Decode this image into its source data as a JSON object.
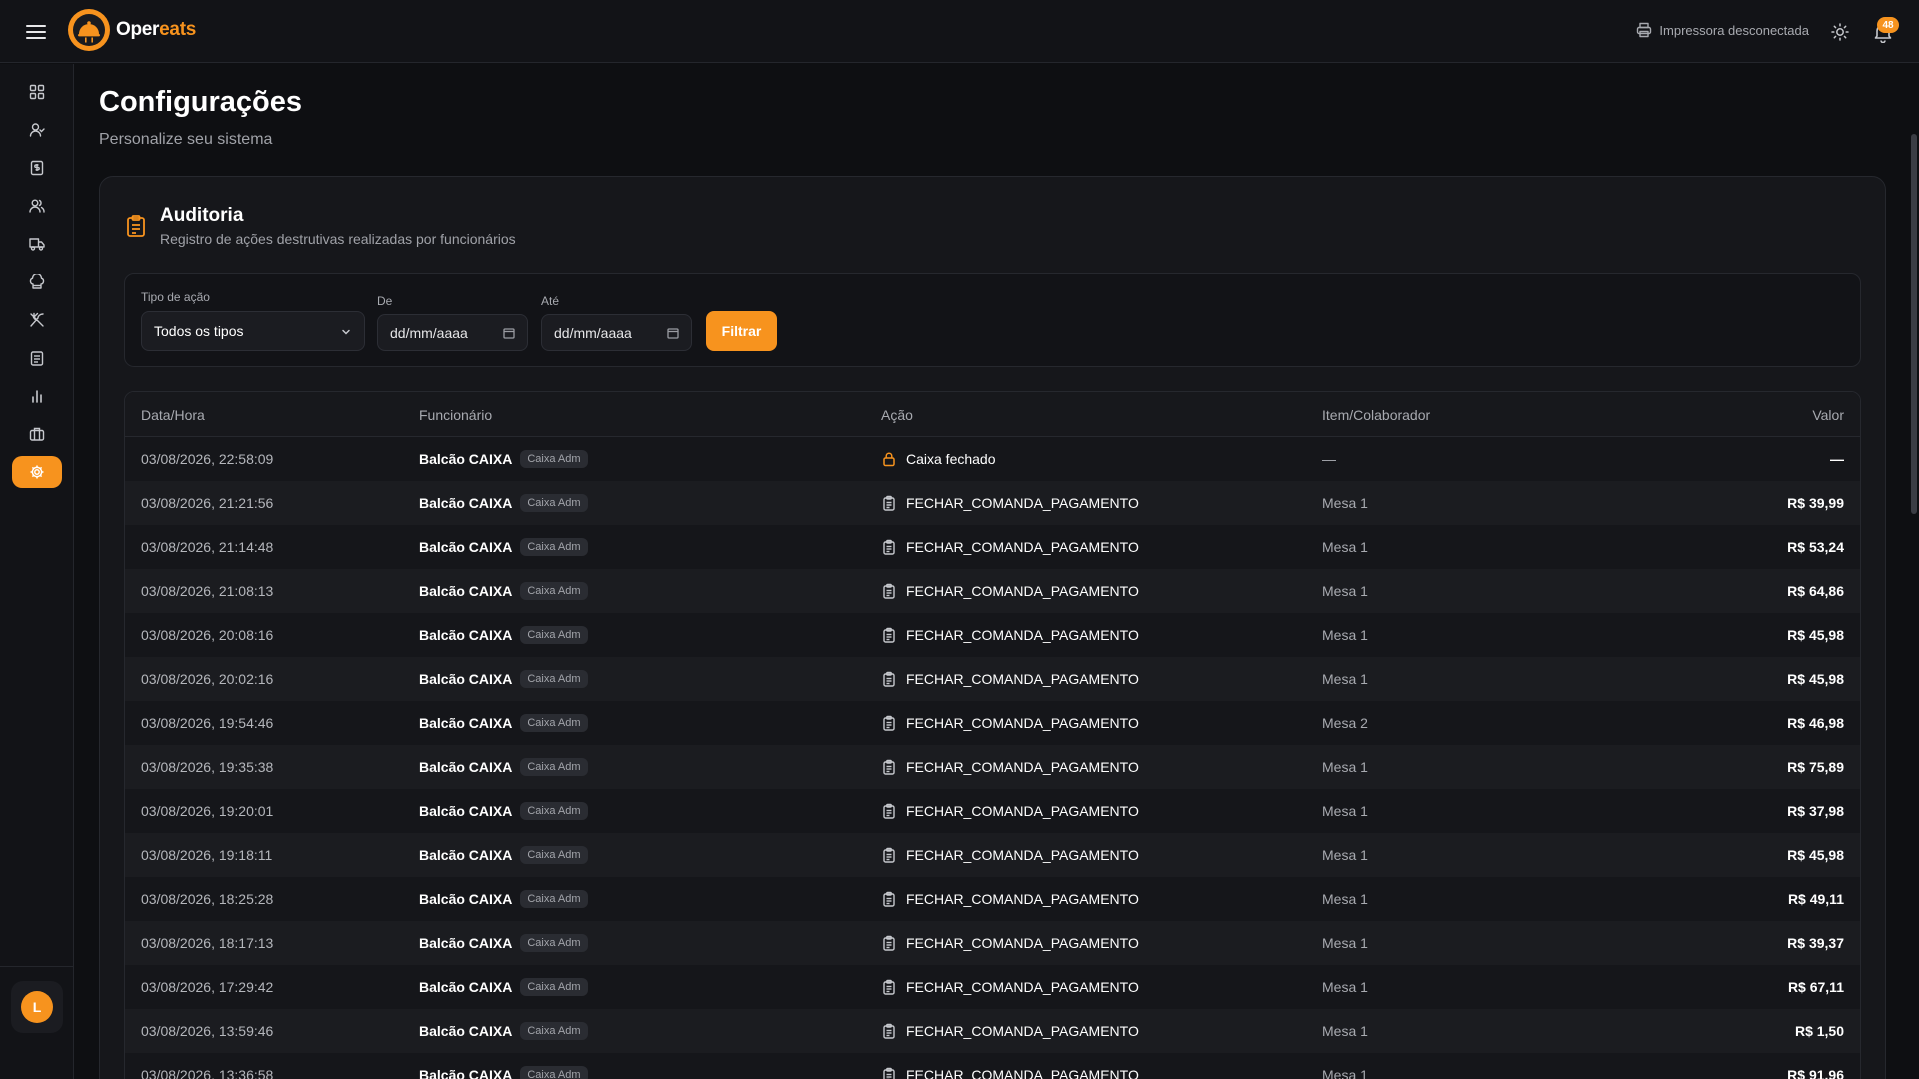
{
  "app": {
    "brand_a": "Oper",
    "brand_b": "eats",
    "printer_status": "Impressora desconectada",
    "notifications_count": "48"
  },
  "sidebar": {
    "icons": [
      "dashboard-icon",
      "user-check-icon",
      "receipt-icon",
      "users-icon",
      "truck-icon",
      "chef-hat-icon",
      "utensils-icon",
      "clipboard-icon",
      "bar-chart-icon",
      "briefcase-icon",
      "gear-icon"
    ],
    "active_index": 10,
    "user_initial": "L"
  },
  "page": {
    "title": "Configurações",
    "subtitle": "Personalize seu sistema"
  },
  "audit": {
    "title": "Auditoria",
    "subtitle": "Registro de ações destrutivas realizadas por funcionários",
    "filters": {
      "type_label": "Tipo de ação",
      "type_value": "Todos os tipos",
      "from_label": "De",
      "from_value": "dd/mm/aaaa",
      "to_label": "Até",
      "to_value": "dd/mm/aaaa",
      "button": "Filtrar"
    },
    "columns": [
      "Data/Hora",
      "Funcionário",
      "Ação",
      "Item/Colaborador",
      "Valor"
    ],
    "rows": [
      {
        "datetime": "03/08/2026, 22:58:09",
        "employee": "Balcão CAIXA",
        "role": "Caixa Adm",
        "action_icon": "lock-icon",
        "action": "Caixa fechado",
        "item": "—",
        "value": "—"
      },
      {
        "datetime": "03/08/2026, 21:21:56",
        "employee": "Balcão CAIXA",
        "role": "Caixa Adm",
        "action_icon": "clipboard-icon",
        "action": "FECHAR_COMANDA_PAGAMENTO",
        "item": "Mesa 1",
        "value": "R$ 39,99"
      },
      {
        "datetime": "03/08/2026, 21:14:48",
        "employee": "Balcão CAIXA",
        "role": "Caixa Adm",
        "action_icon": "clipboard-icon",
        "action": "FECHAR_COMANDA_PAGAMENTO",
        "item": "Mesa 1",
        "value": "R$ 53,24"
      },
      {
        "datetime": "03/08/2026, 21:08:13",
        "employee": "Balcão CAIXA",
        "role": "Caixa Adm",
        "action_icon": "clipboard-icon",
        "action": "FECHAR_COMANDA_PAGAMENTO",
        "item": "Mesa 1",
        "value": "R$ 64,86"
      },
      {
        "datetime": "03/08/2026, 20:08:16",
        "employee": "Balcão CAIXA",
        "role": "Caixa Adm",
        "action_icon": "clipboard-icon",
        "action": "FECHAR_COMANDA_PAGAMENTO",
        "item": "Mesa 1",
        "value": "R$ 45,98"
      },
      {
        "datetime": "03/08/2026, 20:02:16",
        "employee": "Balcão CAIXA",
        "role": "Caixa Adm",
        "action_icon": "clipboard-icon",
        "action": "FECHAR_COMANDA_PAGAMENTO",
        "item": "Mesa 1",
        "value": "R$ 45,98"
      },
      {
        "datetime": "03/08/2026, 19:54:46",
        "employee": "Balcão CAIXA",
        "role": "Caixa Adm",
        "action_icon": "clipboard-icon",
        "action": "FECHAR_COMANDA_PAGAMENTO",
        "item": "Mesa 2",
        "value": "R$ 46,98"
      },
      {
        "datetime": "03/08/2026, 19:35:38",
        "employee": "Balcão CAIXA",
        "role": "Caixa Adm",
        "action_icon": "clipboard-icon",
        "action": "FECHAR_COMANDA_PAGAMENTO",
        "item": "Mesa 1",
        "value": "R$ 75,89"
      },
      {
        "datetime": "03/08/2026, 19:20:01",
        "employee": "Balcão CAIXA",
        "role": "Caixa Adm",
        "action_icon": "clipboard-icon",
        "action": "FECHAR_COMANDA_PAGAMENTO",
        "item": "Mesa 1",
        "value": "R$ 37,98"
      },
      {
        "datetime": "03/08/2026, 19:18:11",
        "employee": "Balcão CAIXA",
        "role": "Caixa Adm",
        "action_icon": "clipboard-icon",
        "action": "FECHAR_COMANDA_PAGAMENTO",
        "item": "Mesa 1",
        "value": "R$ 45,98"
      },
      {
        "datetime": "03/08/2026, 18:25:28",
        "employee": "Balcão CAIXA",
        "role": "Caixa Adm",
        "action_icon": "clipboard-icon",
        "action": "FECHAR_COMANDA_PAGAMENTO",
        "item": "Mesa 1",
        "value": "R$ 49,11"
      },
      {
        "datetime": "03/08/2026, 18:17:13",
        "employee": "Balcão CAIXA",
        "role": "Caixa Adm",
        "action_icon": "clipboard-icon",
        "action": "FECHAR_COMANDA_PAGAMENTO",
        "item": "Mesa 1",
        "value": "R$ 39,37"
      },
      {
        "datetime": "03/08/2026, 17:29:42",
        "employee": "Balcão CAIXA",
        "role": "Caixa Adm",
        "action_icon": "clipboard-icon",
        "action": "FECHAR_COMANDA_PAGAMENTO",
        "item": "Mesa 1",
        "value": "R$ 67,11"
      },
      {
        "datetime": "03/08/2026, 13:59:46",
        "employee": "Balcão CAIXA",
        "role": "Caixa Adm",
        "action_icon": "clipboard-icon",
        "action": "FECHAR_COMANDA_PAGAMENTO",
        "item": "Mesa 1",
        "value": "R$ 1,50"
      },
      {
        "datetime": "03/08/2026, 13:36:58",
        "employee": "Balcão CAIXA",
        "role": "Caixa Adm",
        "action_icon": "clipboard-icon",
        "action": "FECHAR_COMANDA_PAGAMENTO",
        "item": "Mesa 1",
        "value": "R$ 91,96"
      }
    ]
  },
  "colors": {
    "accent": "#f7931e",
    "background": "#0e0f12",
    "surface": "#16171b"
  }
}
